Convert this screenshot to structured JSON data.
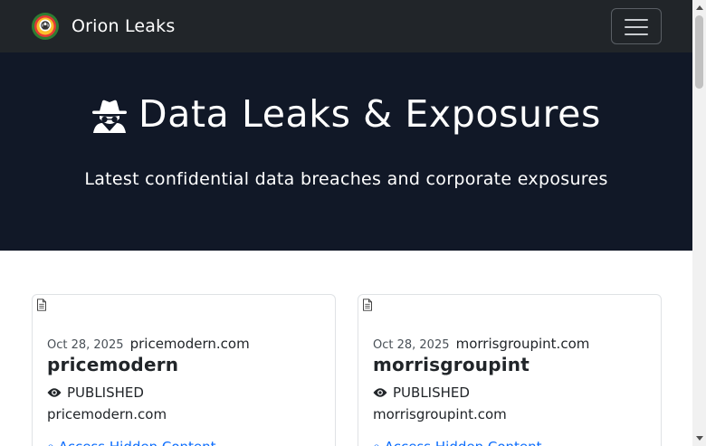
{
  "navbar": {
    "brand": "Orion Leaks",
    "logo_icon": "orion-logo-icon",
    "toggle_icon": "hamburger-menu-icon"
  },
  "hero": {
    "icon": "user-secret-icon",
    "title": "Data Leaks & Exposures",
    "subtitle": "Latest confidential data breaches and corporate exposures",
    "background": "#111827"
  },
  "cards": [
    {
      "icon": "document-icon",
      "date": "Oct 28, 2025",
      "domain": "pricemodern.com",
      "title": "pricemodern",
      "status_icon": "eye-icon",
      "status": "PUBLISHED",
      "url": "pricemodern.com",
      "link_icon": "lock-icon",
      "link": "Access Hidden Content"
    },
    {
      "icon": "document-icon",
      "date": "Oct 28, 2025",
      "domain": "morrisgroupint.com",
      "title": "morrisgroupint",
      "status_icon": "eye-icon",
      "status": "PUBLISHED",
      "url": "morrisgroupint.com",
      "link_icon": "lock-icon",
      "link": "Access Hidden Content"
    }
  ],
  "colors": {
    "navbar": "#212529",
    "hero": "#111827",
    "link": "#0d6efd"
  }
}
